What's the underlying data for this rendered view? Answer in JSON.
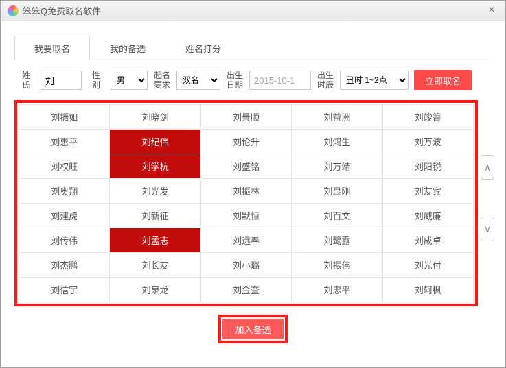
{
  "window": {
    "title": "笨笨Q免费取名软件"
  },
  "tabs": [
    {
      "label": "我要取名",
      "active": true
    },
    {
      "label": "我的备选",
      "active": false
    },
    {
      "label": "姓名打分",
      "active": false
    }
  ],
  "form": {
    "surname_label": "姓\n氏",
    "surname_value": "刘",
    "gender_label": "性\n别",
    "gender_value": "男",
    "nametype_label": "起名\n要求",
    "nametype_value": "双名",
    "birthdate_label": "出生\n日期",
    "birthdate_value": "2015-10-1",
    "birthhour_label": "出生\n时辰",
    "birthhour_value": "丑时 1~2点",
    "submit_label": "立即取名"
  },
  "names": [
    [
      "刘振如",
      "刘晓剑",
      "刘景顺",
      "刘益洲",
      "刘竣箐"
    ],
    [
      "刘惠平",
      "刘纪伟",
      "刘伦升",
      "刘鸿生",
      "刘万波"
    ],
    [
      "刘权旺",
      "刘学杭",
      "刘盛铭",
      "刘万靖",
      "刘阳锐"
    ],
    [
      "刘奥翔",
      "刘光发",
      "刘振林",
      "刘显刚",
      "刘友宾"
    ],
    [
      "刘建虎",
      "刘新征",
      "刘默恒",
      "刘百文",
      "刘威廉"
    ],
    [
      "刘传伟",
      "刘孟志",
      "刘远奉",
      "刘鹭露",
      "刘成卓"
    ],
    [
      "刘杰鹏",
      "刘长友",
      "刘小璐",
      "刘振伟",
      "刘光付"
    ],
    [
      "刘信宇",
      "刘泉龙",
      "刘金奎",
      "刘忠平",
      "刘轲枫"
    ]
  ],
  "selected": [
    [
      1,
      1
    ],
    [
      2,
      1
    ],
    [
      5,
      1
    ]
  ],
  "footer": {
    "add_label": "加入备选"
  }
}
